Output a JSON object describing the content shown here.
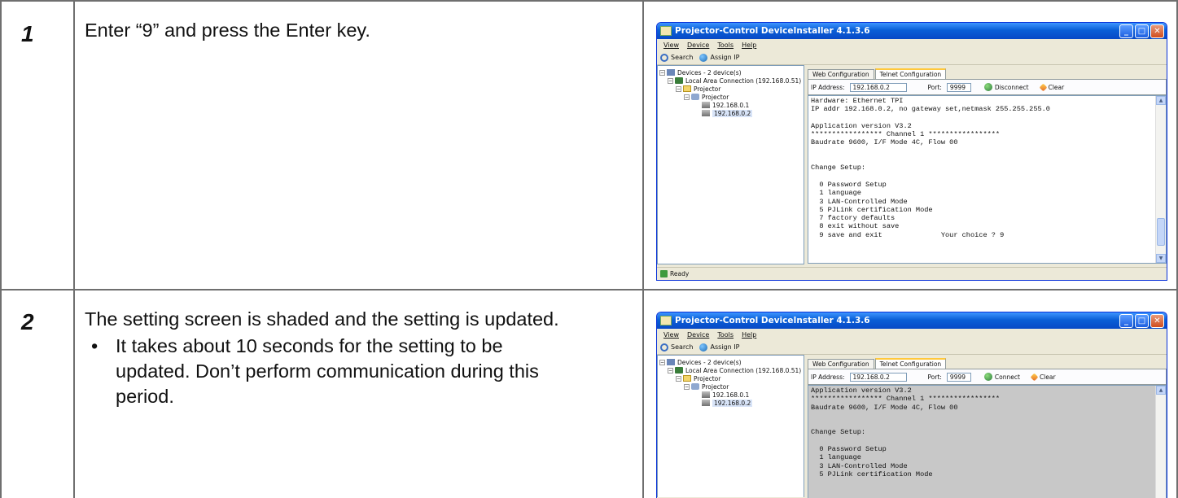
{
  "steps": [
    {
      "number": "1",
      "text": "Enter “9” and press the Enter key.",
      "window": {
        "title": "Projector-Control DeviceInstaller 4.1.3.6",
        "menu": [
          "View",
          "Device",
          "Tools",
          "Help"
        ],
        "toolbar": {
          "search": "Search",
          "assign_ip": "Assign IP"
        },
        "tree": {
          "root": "Devices - 2 device(s)",
          "connection": "Local Area Connection (192.168.0.51)",
          "folder": "Projector",
          "group": "Projector",
          "nodes": [
            "192.168.0.1",
            "192.168.0.2"
          ]
        },
        "tabs": [
          "Web Configuration",
          "Telnet Configuration"
        ],
        "ip_label": "IP Address:",
        "ip_value": "192.168.0.2",
        "port_label": "Port:",
        "port_value": "9999",
        "connect_label": "Disconnect",
        "clear_label": "Clear",
        "terminal": "Hardware: Ethernet TPI\nIP addr 192.168.0.2, no gateway set,netmask 255.255.255.0\n\nApplication version V3.2\n***************** Channel 1 *****************\nBaudrate 9600, I/F Mode 4C, Flow 00\n\n\nChange Setup:\n\n  0 Password Setup\n  1 language\n  3 LAN-Controlled Mode\n  5 PJLink certification Mode\n  7 factory defaults\n  8 exit without save\n  9 save and exit              Your choice ? 9",
        "status": "Ready"
      }
    },
    {
      "number": "2",
      "text": "The setting screen is shaded and the setting is updated.",
      "bullet": "It takes about 10 seconds for the setting to be updated. Don’t perform communication during this period.",
      "bullet_mark": "•",
      "window": {
        "title": "Projector-Control DeviceInstaller 4.1.3.6",
        "menu": [
          "View",
          "Device",
          "Tools",
          "Help"
        ],
        "toolbar": {
          "search": "Search",
          "assign_ip": "Assign IP"
        },
        "tree": {
          "root": "Devices - 2 device(s)",
          "connection": "Local Area Connection (192.168.0.51)",
          "folder": "Projector",
          "group": "Projector",
          "nodes": [
            "192.168.0.1",
            "192.168.0.2"
          ]
        },
        "tabs": [
          "Web Configuration",
          "Telnet Configuration"
        ],
        "ip_label": "IP Address:",
        "ip_value": "192.168.0.2",
        "port_label": "Port:",
        "port_value": "9999",
        "connect_label": "Connect",
        "clear_label": "Clear",
        "terminal": "Application version V3.2\n***************** Channel 1 *****************\nBaudrate 9600, I/F Mode 4C, Flow 00\n\n\nChange Setup:\n\n  0 Password Setup\n  1 language\n  3 LAN-Controlled Mode\n  5 PJLink certification Mode"
      }
    }
  ],
  "colors": {
    "rule": "#6f6f6f",
    "xp_title": "#0a5fd7",
    "shade": "#c8c8c8"
  }
}
